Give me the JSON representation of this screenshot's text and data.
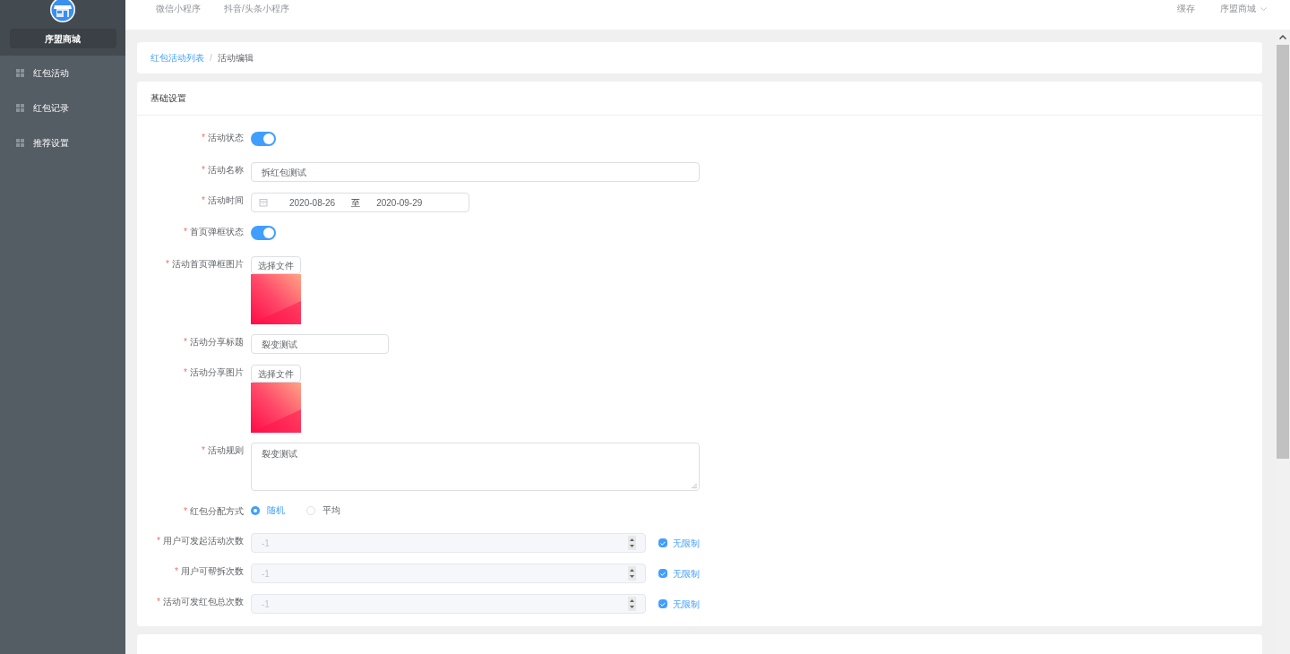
{
  "sidebar": {
    "shop_name": "序盟商城",
    "items": [
      {
        "label": "红包活动",
        "selected": false
      },
      {
        "label": "红包记录",
        "selected": false
      },
      {
        "label": "推荐设置",
        "selected": false
      }
    ]
  },
  "top_bar": {
    "tabs": [
      {
        "label": "微信小程序",
        "selected": false
      },
      {
        "label": "抖音/头条小程序",
        "selected": false
      }
    ],
    "cache": "缓存",
    "account": "序盟商城"
  },
  "breadcrumb": [
    {
      "label": "红包活动列表",
      "kind": "link"
    },
    {
      "label": "活动编辑",
      "kind": "current"
    }
  ],
  "breadcrumb_separator": "/",
  "card": {
    "title": "基础设置",
    "fields": [
      {
        "kind": "switch",
        "label": "活动状态",
        "required_mark": "*",
        "on": true
      },
      {
        "kind": "text",
        "label": "活动名称",
        "required_mark": "*",
        "value": "拆红包测试",
        "wide": true
      },
      {
        "kind": "daterange",
        "label": "活动时间",
        "required_mark": "*",
        "start": "2020-08-26",
        "separator": "至",
        "end": "2020-09-29"
      },
      {
        "kind": "switch",
        "label": "首页弹框状态",
        "required_mark": "*",
        "on": true
      },
      {
        "kind": "upload",
        "label": "活动首页弹框图片",
        "required_mark": "*",
        "button": "选择文件"
      },
      {
        "kind": "text",
        "label": "活动分享标题",
        "required_mark": "*",
        "value": "裂变测试",
        "wide": false
      },
      {
        "kind": "upload",
        "label": "活动分享图片",
        "required_mark": "*",
        "button": "选择文件"
      },
      {
        "kind": "textarea",
        "label": "活动规则",
        "required_mark": "*",
        "value": "裂变测试"
      },
      {
        "kind": "radio",
        "label": "红包分配方式",
        "required_mark": "*",
        "options": [
          {
            "label": "随机",
            "selected": true
          },
          {
            "label": "平均",
            "selected": false
          }
        ]
      },
      {
        "kind": "number",
        "label": "用户可发起活动次数",
        "required_mark": "*",
        "value": "-1",
        "disabled": true,
        "checkbox": {
          "label": "无限制",
          "checked": true
        }
      },
      {
        "kind": "number",
        "label": "用户可帮拆次数",
        "required_mark": "*",
        "value": "-1",
        "disabled": true,
        "checkbox": {
          "label": "无限制",
          "checked": true
        }
      },
      {
        "kind": "number",
        "label": "活动可发红包总次数",
        "required_mark": "*",
        "value": "-1",
        "disabled": true,
        "checkbox": {
          "label": "无限制",
          "checked": true
        }
      }
    ]
  }
}
